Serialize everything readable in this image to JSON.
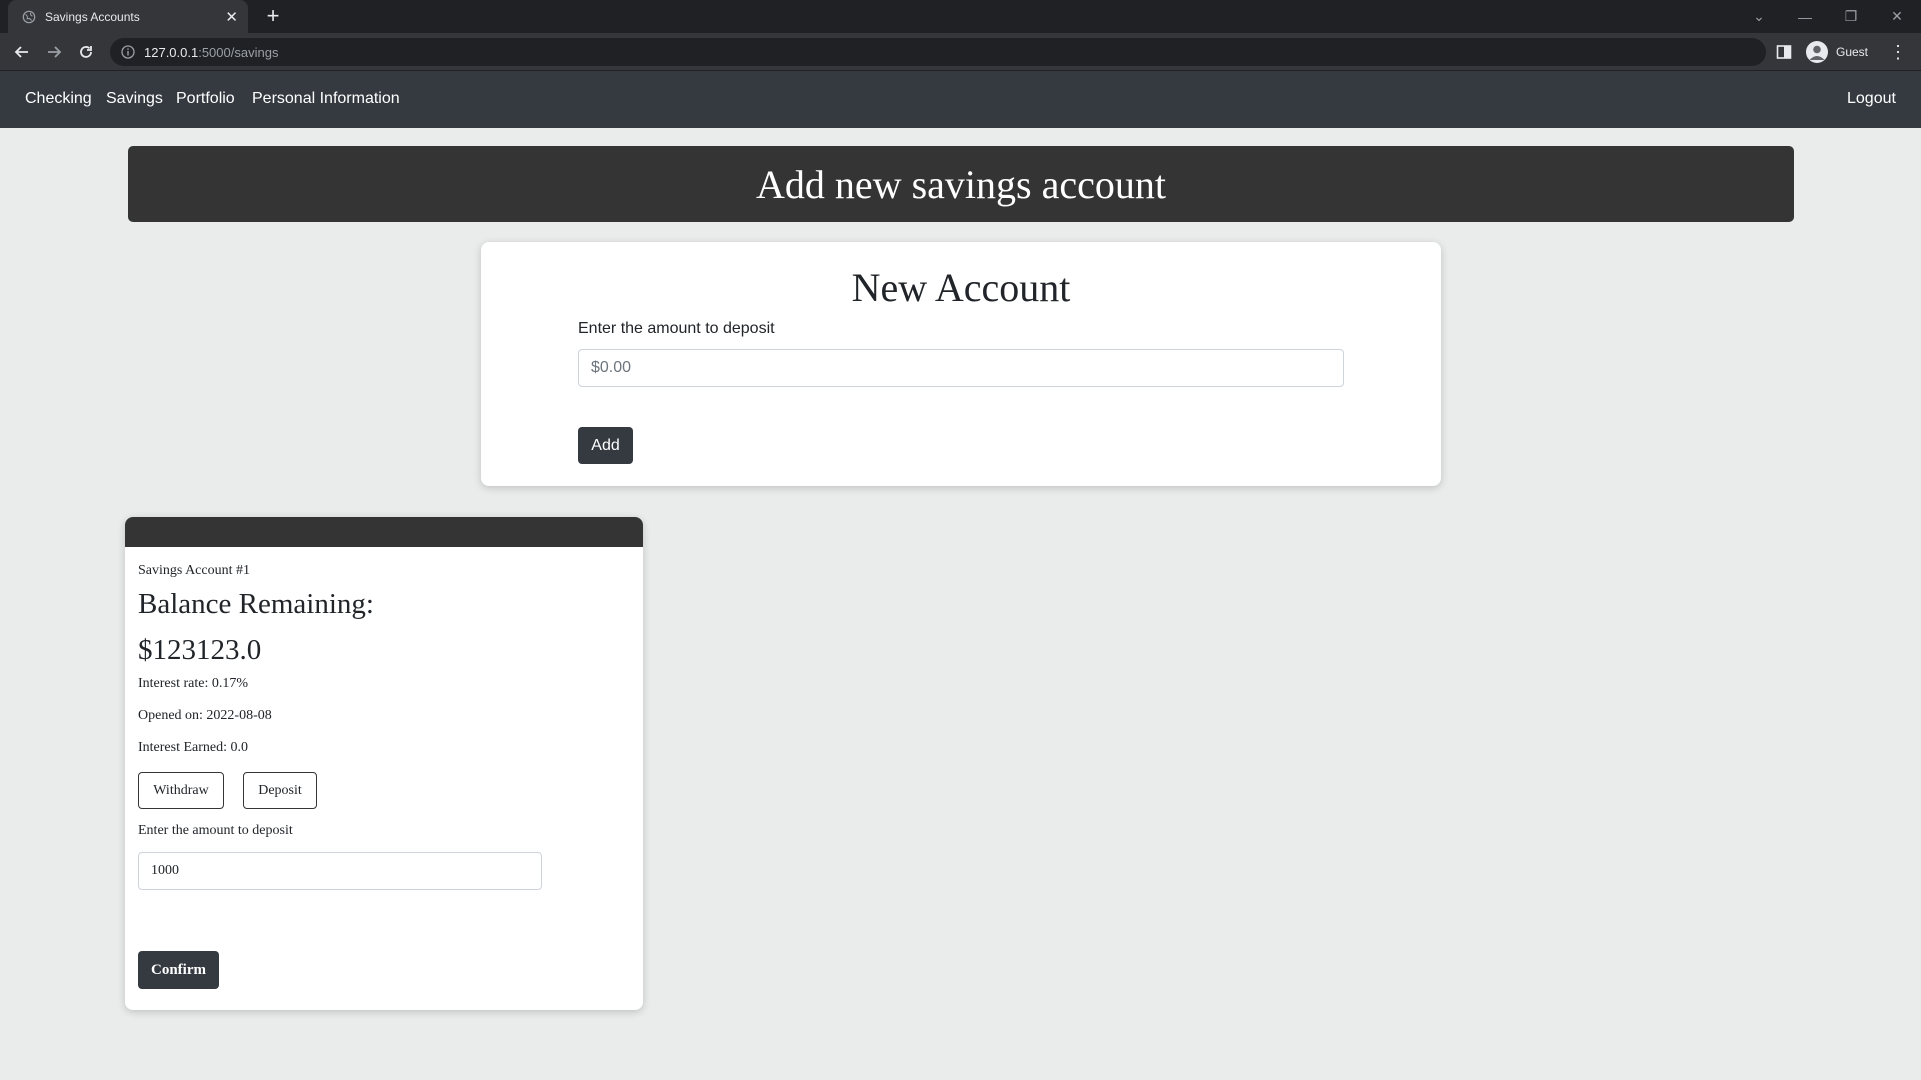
{
  "browser": {
    "tab_title": "Savings Accounts",
    "url_host": "127.0.0.1",
    "url_path": ":5000/savings",
    "profile_label": "Guest"
  },
  "nav": {
    "links": [
      "Checking",
      "Savings",
      "Portfolio",
      "Personal Information"
    ],
    "logout": "Logout"
  },
  "banner": {
    "title": "Add new savings account"
  },
  "new_account": {
    "heading": "New Account",
    "deposit_label": "Enter the amount to deposit",
    "deposit_placeholder": "$0.00",
    "add_button": "Add"
  },
  "account": {
    "name": "Savings Account #1",
    "balance_label": "Balance Remaining:",
    "balance": "$123123.0",
    "interest_rate": "Interest rate: 0.17%",
    "opened_on": "Opened on: 2022-08-08",
    "interest_earned": "Interest Earned: 0.0",
    "withdraw_button": "Withdraw",
    "deposit_button": "Deposit",
    "amount_label": "Enter the amount to deposit",
    "amount_value": "1000",
    "confirm_button": "Confirm"
  },
  "icons": {
    "tab": "globe-icon",
    "close": "close-icon",
    "new_tab": "plus-icon",
    "back": "back-arrow-icon",
    "forward": "forward-arrow-icon",
    "reload": "reload-icon",
    "site_info": "info-icon",
    "side_panel": "side-panel-icon",
    "profile": "profile-icon",
    "menu": "kebab-menu-icon"
  }
}
